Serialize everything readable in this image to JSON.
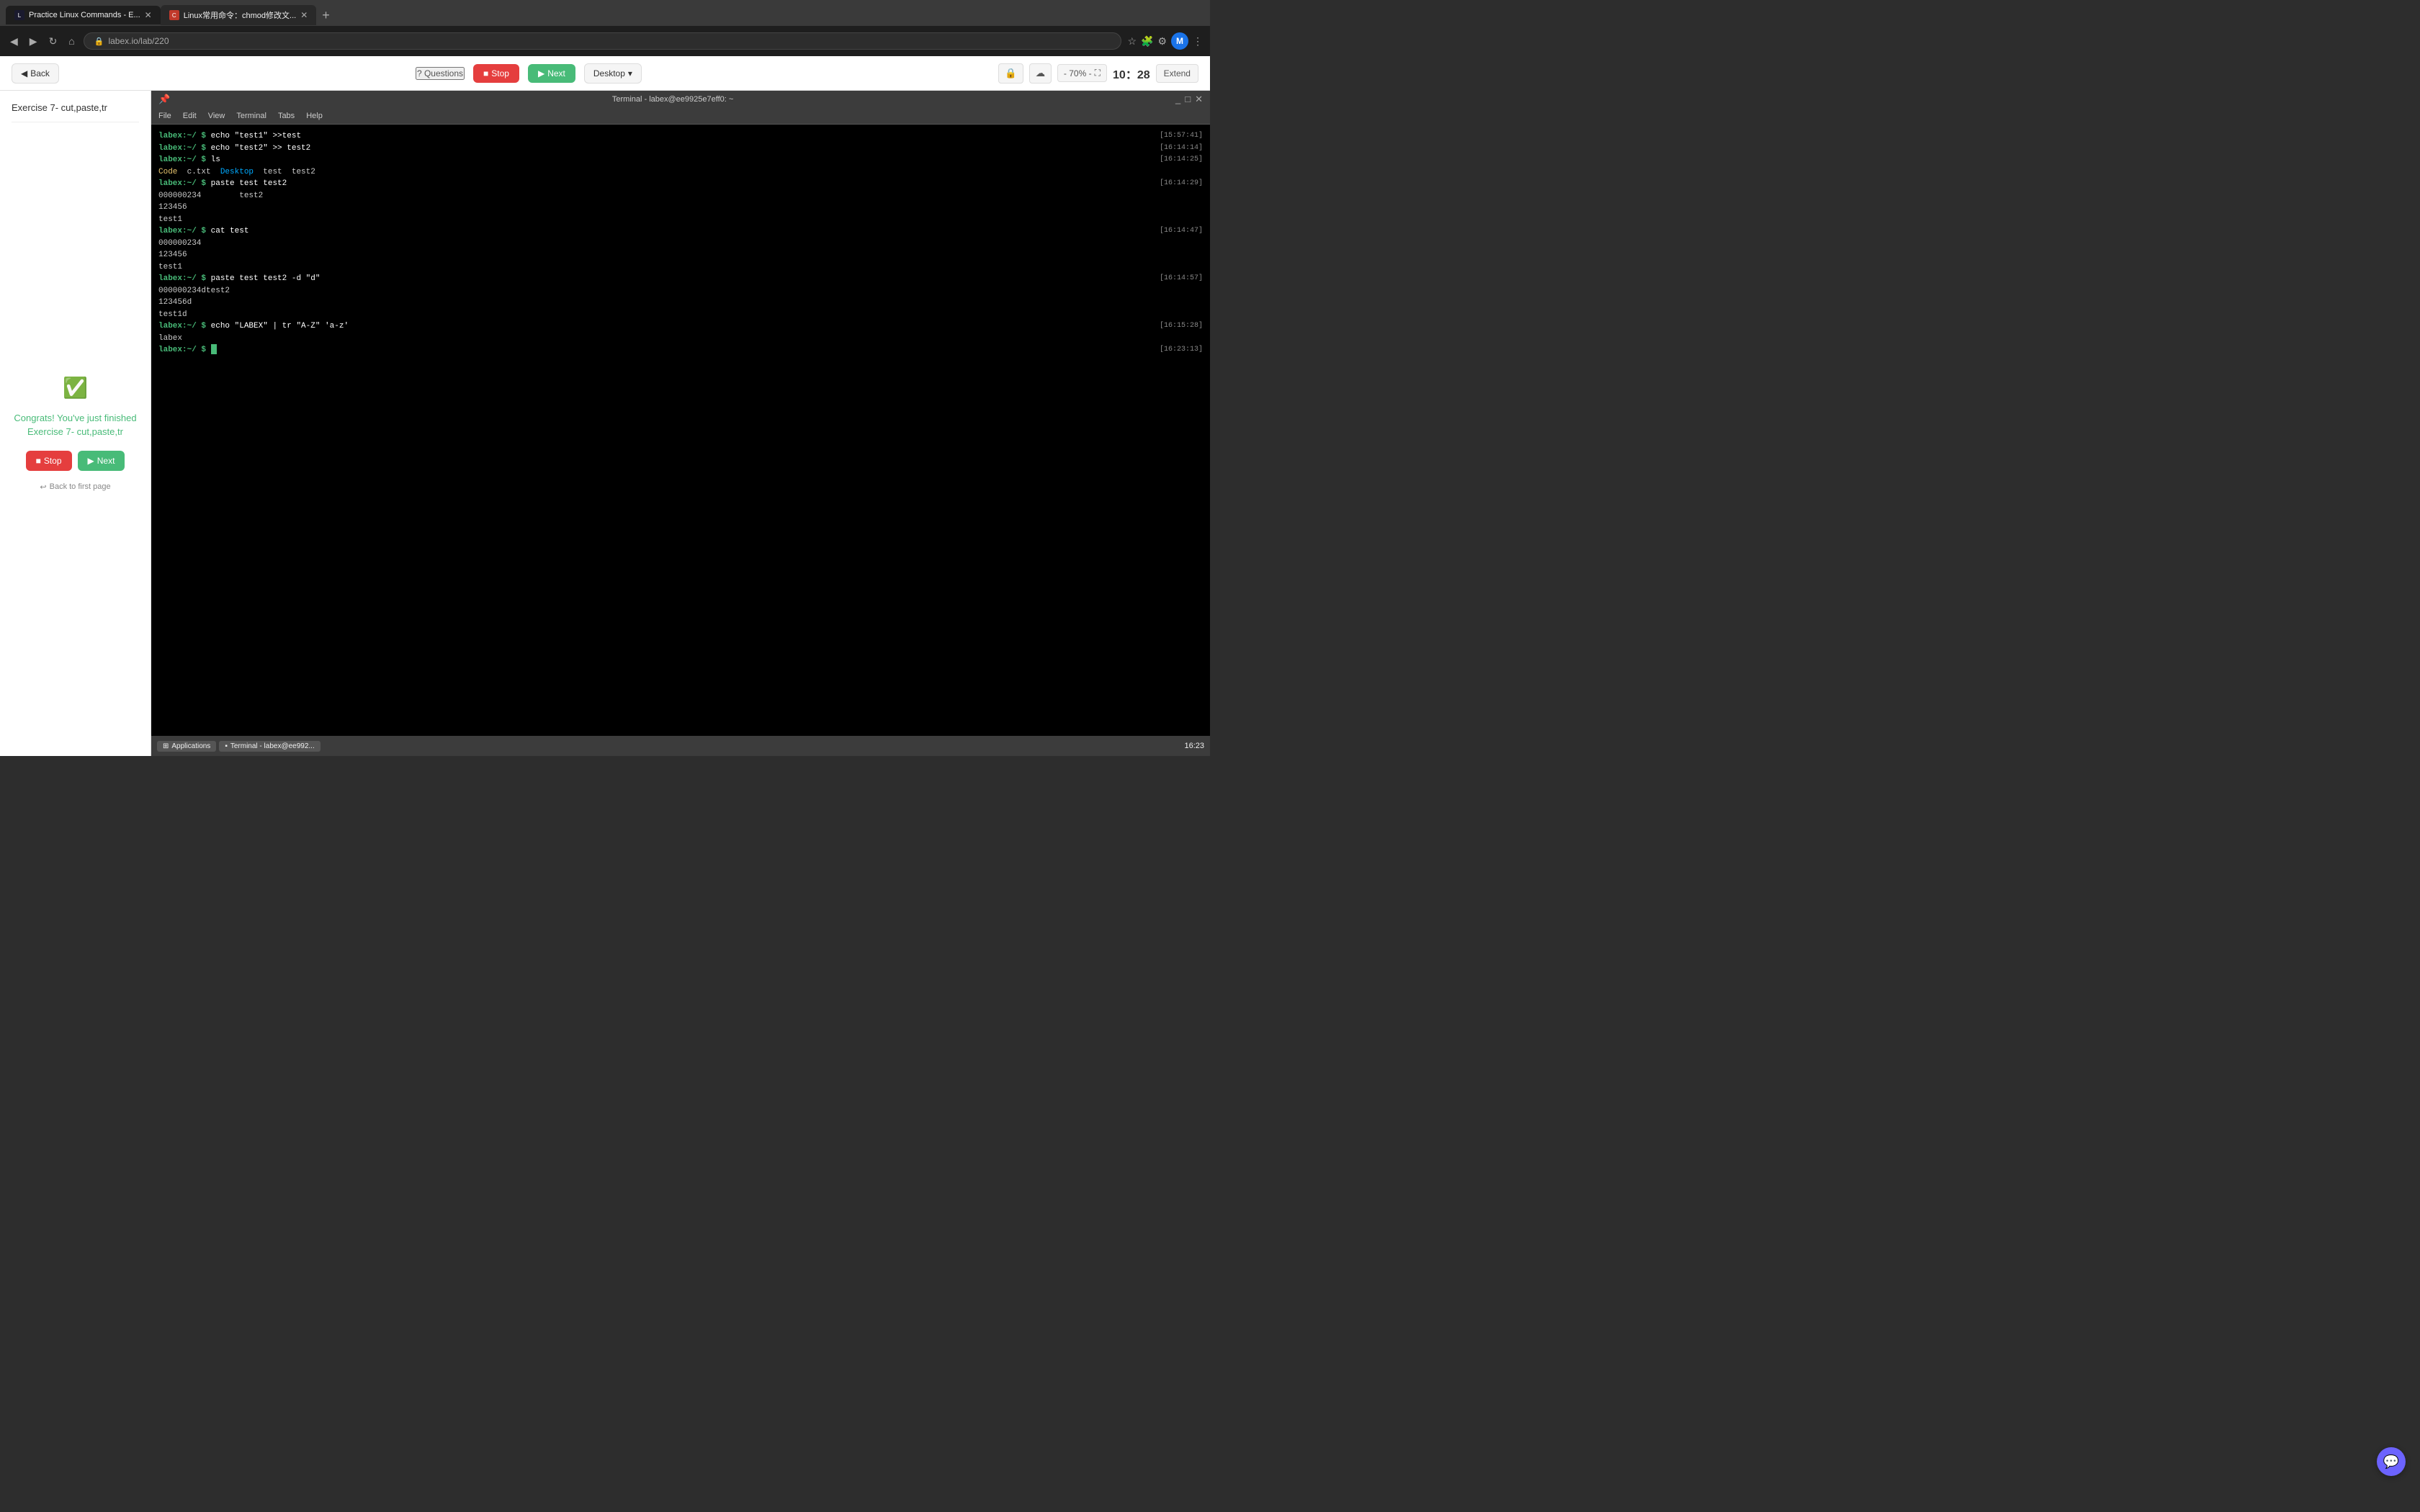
{
  "browser": {
    "tabs": [
      {
        "id": "tab1",
        "label": "Practice Linux Commands - E...",
        "type": "labex",
        "active": true
      },
      {
        "id": "tab2",
        "label": "Linux常用命令：chmod修改文...",
        "type": "chmod",
        "active": false
      }
    ],
    "address": "labex.io/lab/220",
    "add_tab_label": "+"
  },
  "toolbar": {
    "back_label": "Back",
    "questions_label": "? Questions",
    "stop_label": "Stop",
    "next_label": "Next",
    "desktop_label": "Desktop",
    "desktop_chevron": "▾",
    "lock_icon": "🔒",
    "cloud_icon": "☁",
    "zoom_label": "- 70% -",
    "fullscreen_icon": "⛶",
    "time": "10：28",
    "extend_label": "Extend"
  },
  "left_panel": {
    "exercise_title": "Exercise 7- cut,paste,tr",
    "success_text": "Congrats! You've just finished Exercise 7- cut,paste,tr",
    "stop_label": "Stop",
    "next_label": "Next",
    "back_link": "Back to first page"
  },
  "terminal": {
    "title": "Terminal - labex@ee9925e7eff0: ~",
    "menu_items": [
      "File",
      "Edit",
      "View",
      "Terminal",
      "Tabs",
      "Help"
    ],
    "lines": [
      {
        "type": "cmd",
        "prompt": "labex:~/ $ ",
        "cmd": "echo \"test1\" >>test",
        "time": "[15:57:41]"
      },
      {
        "type": "cmd",
        "prompt": "labex:~/ $ ",
        "cmd": "echo \"test2\" >> test2",
        "time": "[16:14:14]"
      },
      {
        "type": "cmd",
        "prompt": "labex:~/ $ ",
        "cmd": "ls",
        "time": "[16:14:25]"
      },
      {
        "type": "output-ls",
        "content": "Code   c.txt   Desktop   test   test2",
        "time": ""
      },
      {
        "type": "cmd",
        "prompt": "labex:~/ $ ",
        "cmd": "paste test test2",
        "time": "[16:14:29]"
      },
      {
        "type": "output",
        "content": "000000234\t\ttest2",
        "time": ""
      },
      {
        "type": "output",
        "content": "123456",
        "time": ""
      },
      {
        "type": "output",
        "content": "test1",
        "time": ""
      },
      {
        "type": "cmd",
        "prompt": "labex:~/ $ ",
        "cmd": "cat test",
        "time": "[16:14:47]"
      },
      {
        "type": "output",
        "content": "000000234",
        "time": ""
      },
      {
        "type": "output",
        "content": "123456",
        "time": ""
      },
      {
        "type": "output",
        "content": "test1",
        "time": ""
      },
      {
        "type": "cmd",
        "prompt": "labex:~/ $ ",
        "cmd": "paste test test2 -d \"d\"",
        "time": "[16:14:57]"
      },
      {
        "type": "output",
        "content": "000000234dtest2",
        "time": ""
      },
      {
        "type": "output",
        "content": "123456d",
        "time": ""
      },
      {
        "type": "output",
        "content": "test1d",
        "time": ""
      },
      {
        "type": "cmd",
        "prompt": "labex:~/ $ ",
        "cmd": "echo \"LABEX\" | tr \"A-Z\" 'a-z'",
        "time": "[16:15:28]"
      },
      {
        "type": "output",
        "content": "labex",
        "time": ""
      },
      {
        "type": "cmd",
        "prompt": "labex:~/ $ ",
        "cmd": "",
        "time": "[16:23:13]"
      }
    ]
  },
  "taskbar": {
    "apps": [
      {
        "label": "Applications"
      },
      {
        "label": "Terminal - labex@ee992..."
      }
    ],
    "time": "16:23"
  }
}
